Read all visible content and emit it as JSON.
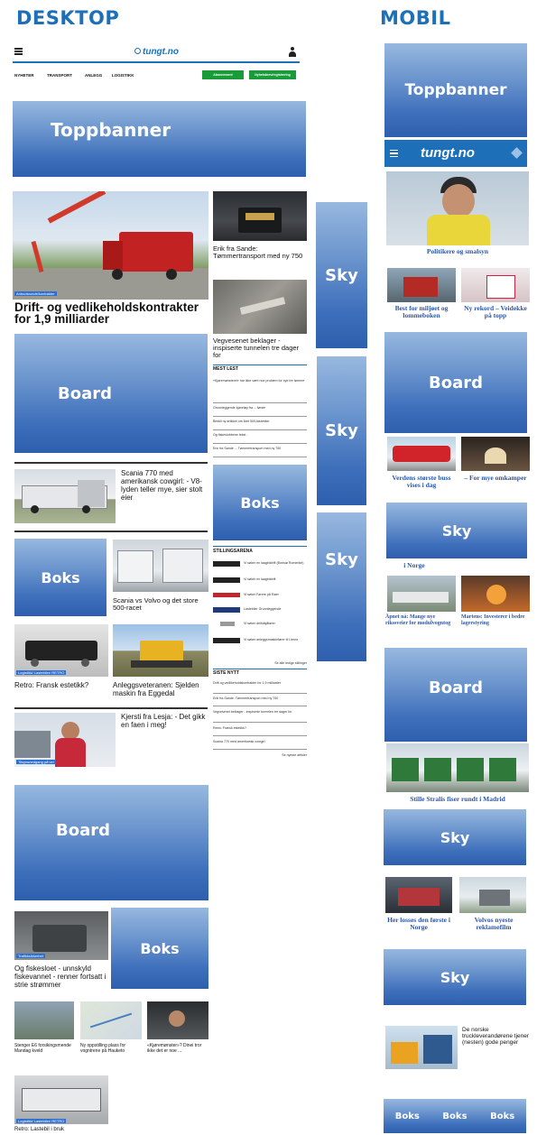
{
  "headings": {
    "desktop": "DESKTOP",
    "mobile": "MOBIL"
  },
  "desktop": {
    "topbar": {
      "menu_icon": "hamburger-icon",
      "logo": "tungt.no",
      "user_icon": "user-icon"
    },
    "nav": {
      "items": [
        "NYHETER",
        "TRANSPORT",
        "ANLEGG",
        "LOGISTIKK"
      ],
      "btn1": "Abonnement",
      "btn2": "Nyhetsbrev/registrering"
    },
    "ads": {
      "toppbanner": "Toppbanner",
      "board1": "Board",
      "board2": "Board",
      "sky1": "Sky",
      "sky2": "Sky",
      "sky3": "Sky",
      "boks1": "Boks",
      "boks2": "Boks",
      "boks3": "Boks"
    },
    "hero": {
      "badge": "Anbudsrunde/kontrakter",
      "title": "Drift- og vedlikeholdskontrakter for 1,9 milliarder"
    },
    "right_articles": [
      {
        "title": "Erik fra Sande: Tømmertransport med ny 750"
      },
      {
        "title": "Vegvesenet beklager - inspiserte tunnelen tre dager for"
      }
    ],
    "mest_lest": {
      "heading": "MEST LEST",
      "items": [
        "«Kjøremønsteret» har ikke vært noe problem for nye tre førerne",
        "Grunnleggende kjøretøy fra ... første",
        "Bestill ny artikkel om året 500-lastebiler",
        "Og fiskeslobbene tekst ..",
        "Eric fra Sande ... Tømmertransport med ny 750"
      ]
    },
    "scania": {
      "title": "Scania 770 med amerikansk cowgirl: - V8-lyden teller mye, sier stolt eier"
    },
    "volvo": {
      "title": "Scania vs Volvo og det store 500-racet"
    },
    "retro": {
      "badge": "Logistikk/ Lastebiler/ RETRO",
      "title": "Retro: Fransk estetikk?"
    },
    "veteran": {
      "title": "Anleggsveteranen: Sjelden maskin fra Eggedal"
    },
    "kjersti": {
      "badge": "Tilsynsnedgang på vei",
      "title": "Kjersti fra Lesja: - Det gikk en faen i meg!"
    },
    "stilling": {
      "heading": "STILLINGSARENA",
      "items": [
        "Vi søker en laagbildrift (Borisiø Romerike)",
        "Vi søker en laagbildrift",
        "Vi søker Førere på Røer",
        "Lastebiler Grunnleggende",
        "Vi søker deltidsjåfører",
        "Vi søker anleggsmaskinfører til Lierne"
      ],
      "more": "Se alle ledige stillinger"
    },
    "siste": {
      "heading": "SISTE NYTT",
      "items": [
        "Drift og vedlikeholdskontrakter for 1,9 milliarder",
        "Erik fra Sande: Tømmertransport med ny 750",
        "Vegvesenet beklager - inspiserte tunnelen tre dager for",
        "Retro: Fransk estetikk?",
        "Scania 770 med amerikansk cowgirl"
      ],
      "more": "Se nyeste artikler"
    },
    "fiskeslo": {
      "badge": "Trafikksikkerhet",
      "title": "Og fiskesloet - unnskyld fiskevannet - renner fortsatt i strie strømmer"
    },
    "bottom_row": [
      {
        "title": "Stenger E6 forsikingsmende Mandag kveld"
      },
      {
        "title": "Ny oppstilling plass for vogntrene på Hauketo"
      },
      {
        "title": "«Kjøremønster»? Dinei tror ikke det er noe ..."
      }
    ],
    "last": {
      "badge": "Logistikk/ Lastebiler/ RETRO",
      "title": "Retro: Lastebil i bruk"
    }
  },
  "mobile": {
    "ads": {
      "toppbanner": "Toppbanner",
      "board1": "Board",
      "board2": "Board",
      "sky1": "Sky",
      "sky2": "Sky",
      "sky3": "Sky",
      "boks": [
        "Boks",
        "Boks",
        "Boks"
      ]
    },
    "header": {
      "menu_icon": "hamburger-icon",
      "logo": "tungt.no",
      "search_icon": "diamond-icon"
    },
    "hero": {
      "title": "Politikere og smalsyn"
    },
    "pair1": [
      {
        "title": "Best for miljøet og lommeboken"
      },
      {
        "title": "Ny rekord – Veidekke på topp"
      }
    ],
    "pair2": [
      {
        "title": "Verdens største buss vises i dag"
      },
      {
        "title": "– For mye omkamper"
      }
    ],
    "snippet": "i Norge",
    "pair3": [
      {
        "title": "Åpnet nå: Mange nye rikssveier for modulvogntog"
      },
      {
        "title": "Martens: Investerer i bedre lagerstyring"
      }
    ],
    "stralis": {
      "title": "Stille Stralis fiser rundt i Madrid"
    },
    "pair4": [
      {
        "title": "Her losses den første i Norge"
      },
      {
        "title": "Volvos nyeste reklamefilm"
      }
    ],
    "bottom": {
      "title": "De norske truckleverandørene tjener (nesten) gode penger"
    }
  }
}
